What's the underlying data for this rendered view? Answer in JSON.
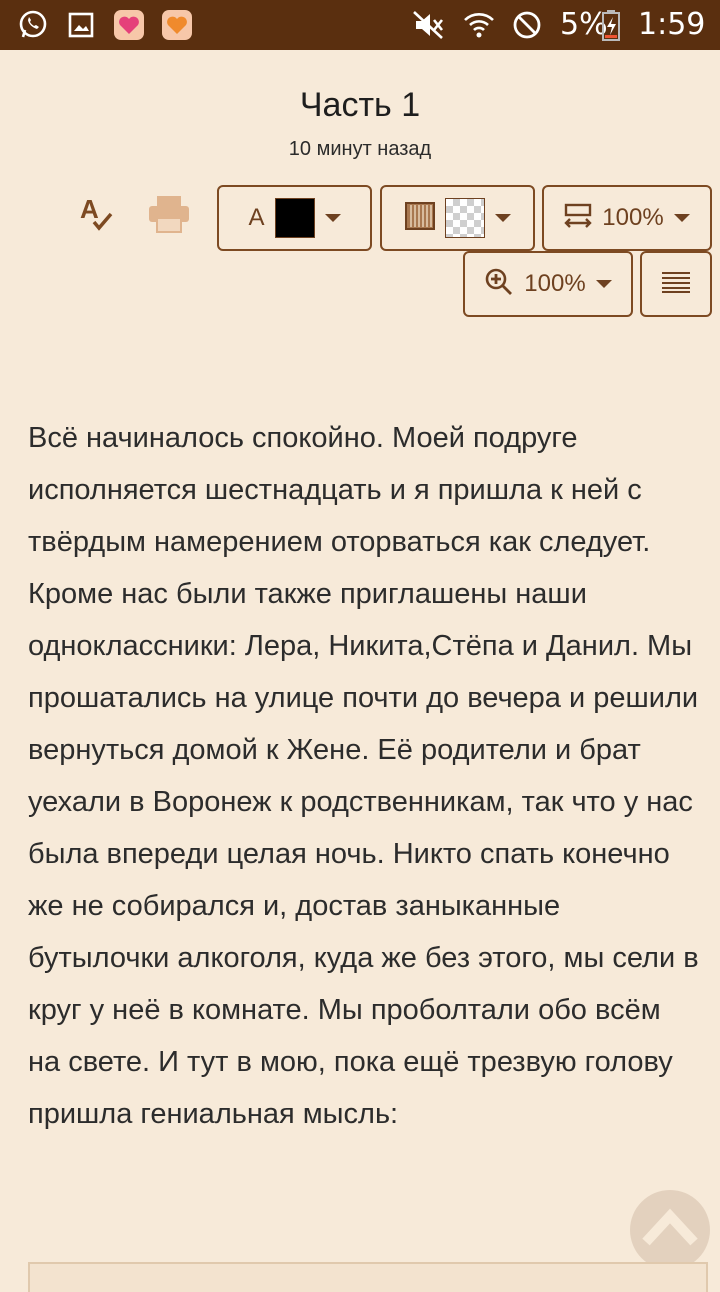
{
  "status_bar": {
    "battery": "5%",
    "time": "1:59",
    "icons": [
      "whatsapp-icon",
      "gallery-icon",
      "heart-app-icon",
      "heart-app-icon",
      "mute-icon",
      "wifi-icon",
      "do-not-disturb-icon",
      "battery-charging-icon"
    ]
  },
  "header": {
    "title": "Часть 1",
    "subtitle": "10 минут назад"
  },
  "toolbar": {
    "spellcheck_icon": "spellcheck-icon",
    "print_icon": "print-icon",
    "font_color_label": "A",
    "font_color": "#000000",
    "background_icon": "book-texture-icon",
    "width_value": "100%",
    "zoom_value": "100%",
    "align_icon": "justify-icon"
  },
  "story": {
    "text": "Всё начиналось спокойно. Моей подруге исполняется шестнадцать и я пришла к ней с твёрдым намерением оторваться как следует. Кроме нас были также приглашены наши одноклассники: Лера, Никита,Стёпа и Данил. Мы прошатались на улице почти до вечера и решили вернуться домой к Жене. Её родители и брат уехали в Воронеж к родственникам, так что у нас была впереди целая ночь. Никто спать конечно же не собирался и, достав заныканные бутылочки алкоголя, куда же без этого, мы сели в круг у неё в комнате. Мы проболтали обо всём на свете. И тут в мою, пока ещё трезвую голову пришла гениальная мысль:"
  },
  "colors": {
    "status_bar": "#5a2f0f",
    "background": "#f7ead9",
    "accent": "#7d4a22"
  }
}
